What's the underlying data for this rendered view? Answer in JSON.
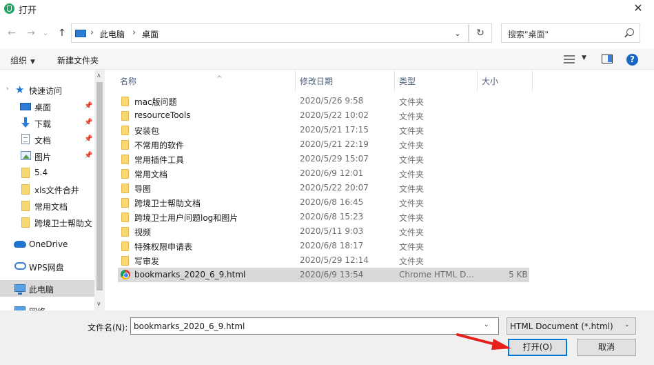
{
  "window": {
    "title": "打开",
    "close_glyph": "✕"
  },
  "nav": {
    "back_glyph": "←",
    "forward_glyph": "→",
    "recent_glyph": "⌄",
    "up_glyph": "↑",
    "refresh_glyph": "↻",
    "dropdown_glyph": "⌄",
    "address": {
      "separator": "›",
      "crumbs": [
        "此电脑",
        "桌面"
      ]
    },
    "search_placeholder": "搜索\"桌面\""
  },
  "toolbar": {
    "organize_label": "组织",
    "organize_caret": "▼",
    "new_folder_label": "新建文件夹",
    "view_caret": "▼",
    "help_glyph": "?"
  },
  "navpane": {
    "expand_glyph": "›",
    "pin_glyph": "📌",
    "quick_access_label": "快速访问",
    "items": [
      {
        "label": "桌面",
        "icon": "desktop-icon",
        "pinned": true
      },
      {
        "label": "下载",
        "icon": "download-icon",
        "pinned": true
      },
      {
        "label": "文档",
        "icon": "document-icon",
        "pinned": true
      },
      {
        "label": "图片",
        "icon": "pictures-icon",
        "pinned": true
      },
      {
        "label": "5.4",
        "icon": "folder-icon",
        "pinned": false
      },
      {
        "label": "xls文件合并",
        "icon": "folder-icon",
        "pinned": false
      },
      {
        "label": "常用文档",
        "icon": "folder-icon",
        "pinned": false
      },
      {
        "label": "跨境卫士帮助文",
        "icon": "folder-icon",
        "pinned": false
      }
    ],
    "onedrive_label": "OneDrive",
    "wps_label": "WPS网盘",
    "this_pc_label": "此电脑",
    "network_label": "网络",
    "scroll_up_glyph": "∧",
    "scroll_down_glyph": "∨"
  },
  "filelist": {
    "sort_caret": "^",
    "columns": {
      "name": "名称",
      "modified": "修改日期",
      "type": "类型",
      "size": "大小"
    },
    "rows": [
      {
        "name": "mac版问题",
        "date": "2020/5/26 9:58",
        "type": "文件夹",
        "size": ""
      },
      {
        "name": "resourceTools",
        "date": "2020/5/22 10:02",
        "type": "文件夹",
        "size": ""
      },
      {
        "name": "安装包",
        "date": "2020/5/21 17:15",
        "type": "文件夹",
        "size": ""
      },
      {
        "name": "不常用的软件",
        "date": "2020/5/21 22:19",
        "type": "文件夹",
        "size": ""
      },
      {
        "name": "常用插件工具",
        "date": "2020/5/29 15:07",
        "type": "文件夹",
        "size": ""
      },
      {
        "name": "常用文档",
        "date": "2020/6/9 12:01",
        "type": "文件夹",
        "size": ""
      },
      {
        "name": "导图",
        "date": "2020/5/22 20:07",
        "type": "文件夹",
        "size": ""
      },
      {
        "name": "跨境卫士帮助文档",
        "date": "2020/6/8 16:45",
        "type": "文件夹",
        "size": ""
      },
      {
        "name": "跨境卫士用户问题log和图片",
        "date": "2020/6/8 15:23",
        "type": "文件夹",
        "size": ""
      },
      {
        "name": "视频",
        "date": "2020/5/11 9:03",
        "type": "文件夹",
        "size": ""
      },
      {
        "name": "特殊权限申请表",
        "date": "2020/6/8 18:17",
        "type": "文件夹",
        "size": ""
      },
      {
        "name": "写审发",
        "date": "2020/5/29 12:14",
        "type": "文件夹",
        "size": ""
      },
      {
        "name": "bookmarks_2020_6_9.html",
        "date": "2020/6/9 13:54",
        "type": "Chrome HTML D...",
        "size": "5 KB"
      }
    ]
  },
  "footer": {
    "filename_label": "文件名(N):",
    "filename_value": "bookmarks_2020_6_9.html",
    "filename_caret": "⌄",
    "filter_value": "HTML Document (*.html)",
    "filter_caret": "⌄",
    "open_label": "打开(O)",
    "cancel_label": "取消"
  },
  "colors": {
    "accent": "#0078d7",
    "annotation_arrow": "#e8201c",
    "selection": "#cce8ff"
  }
}
